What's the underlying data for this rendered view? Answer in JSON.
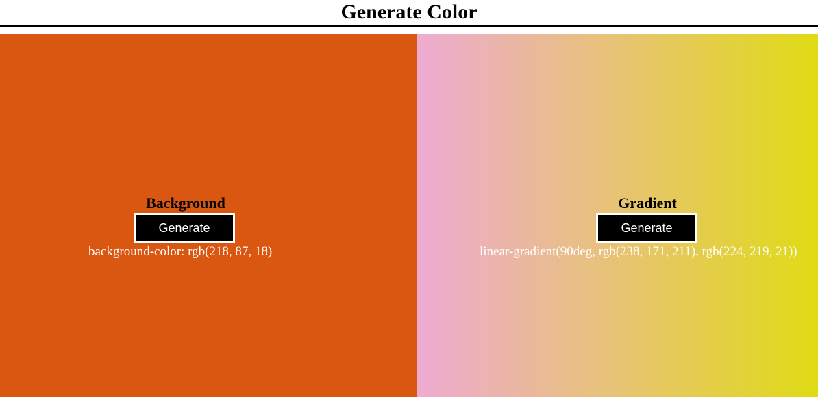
{
  "header": {
    "title": "Generate Color"
  },
  "background_panel": {
    "title": "Background",
    "button_label": "Generate",
    "value_text": "background-color: rgb(218, 87, 18)",
    "color": "#da5712"
  },
  "gradient_panel": {
    "title": "Gradient",
    "button_label": "Generate",
    "value_text": "linear-gradient(90deg, rgb(238, 171, 211), rgb(224, 219, 21))",
    "color_start": "#eeabd3",
    "color_end": "#e0db15"
  }
}
